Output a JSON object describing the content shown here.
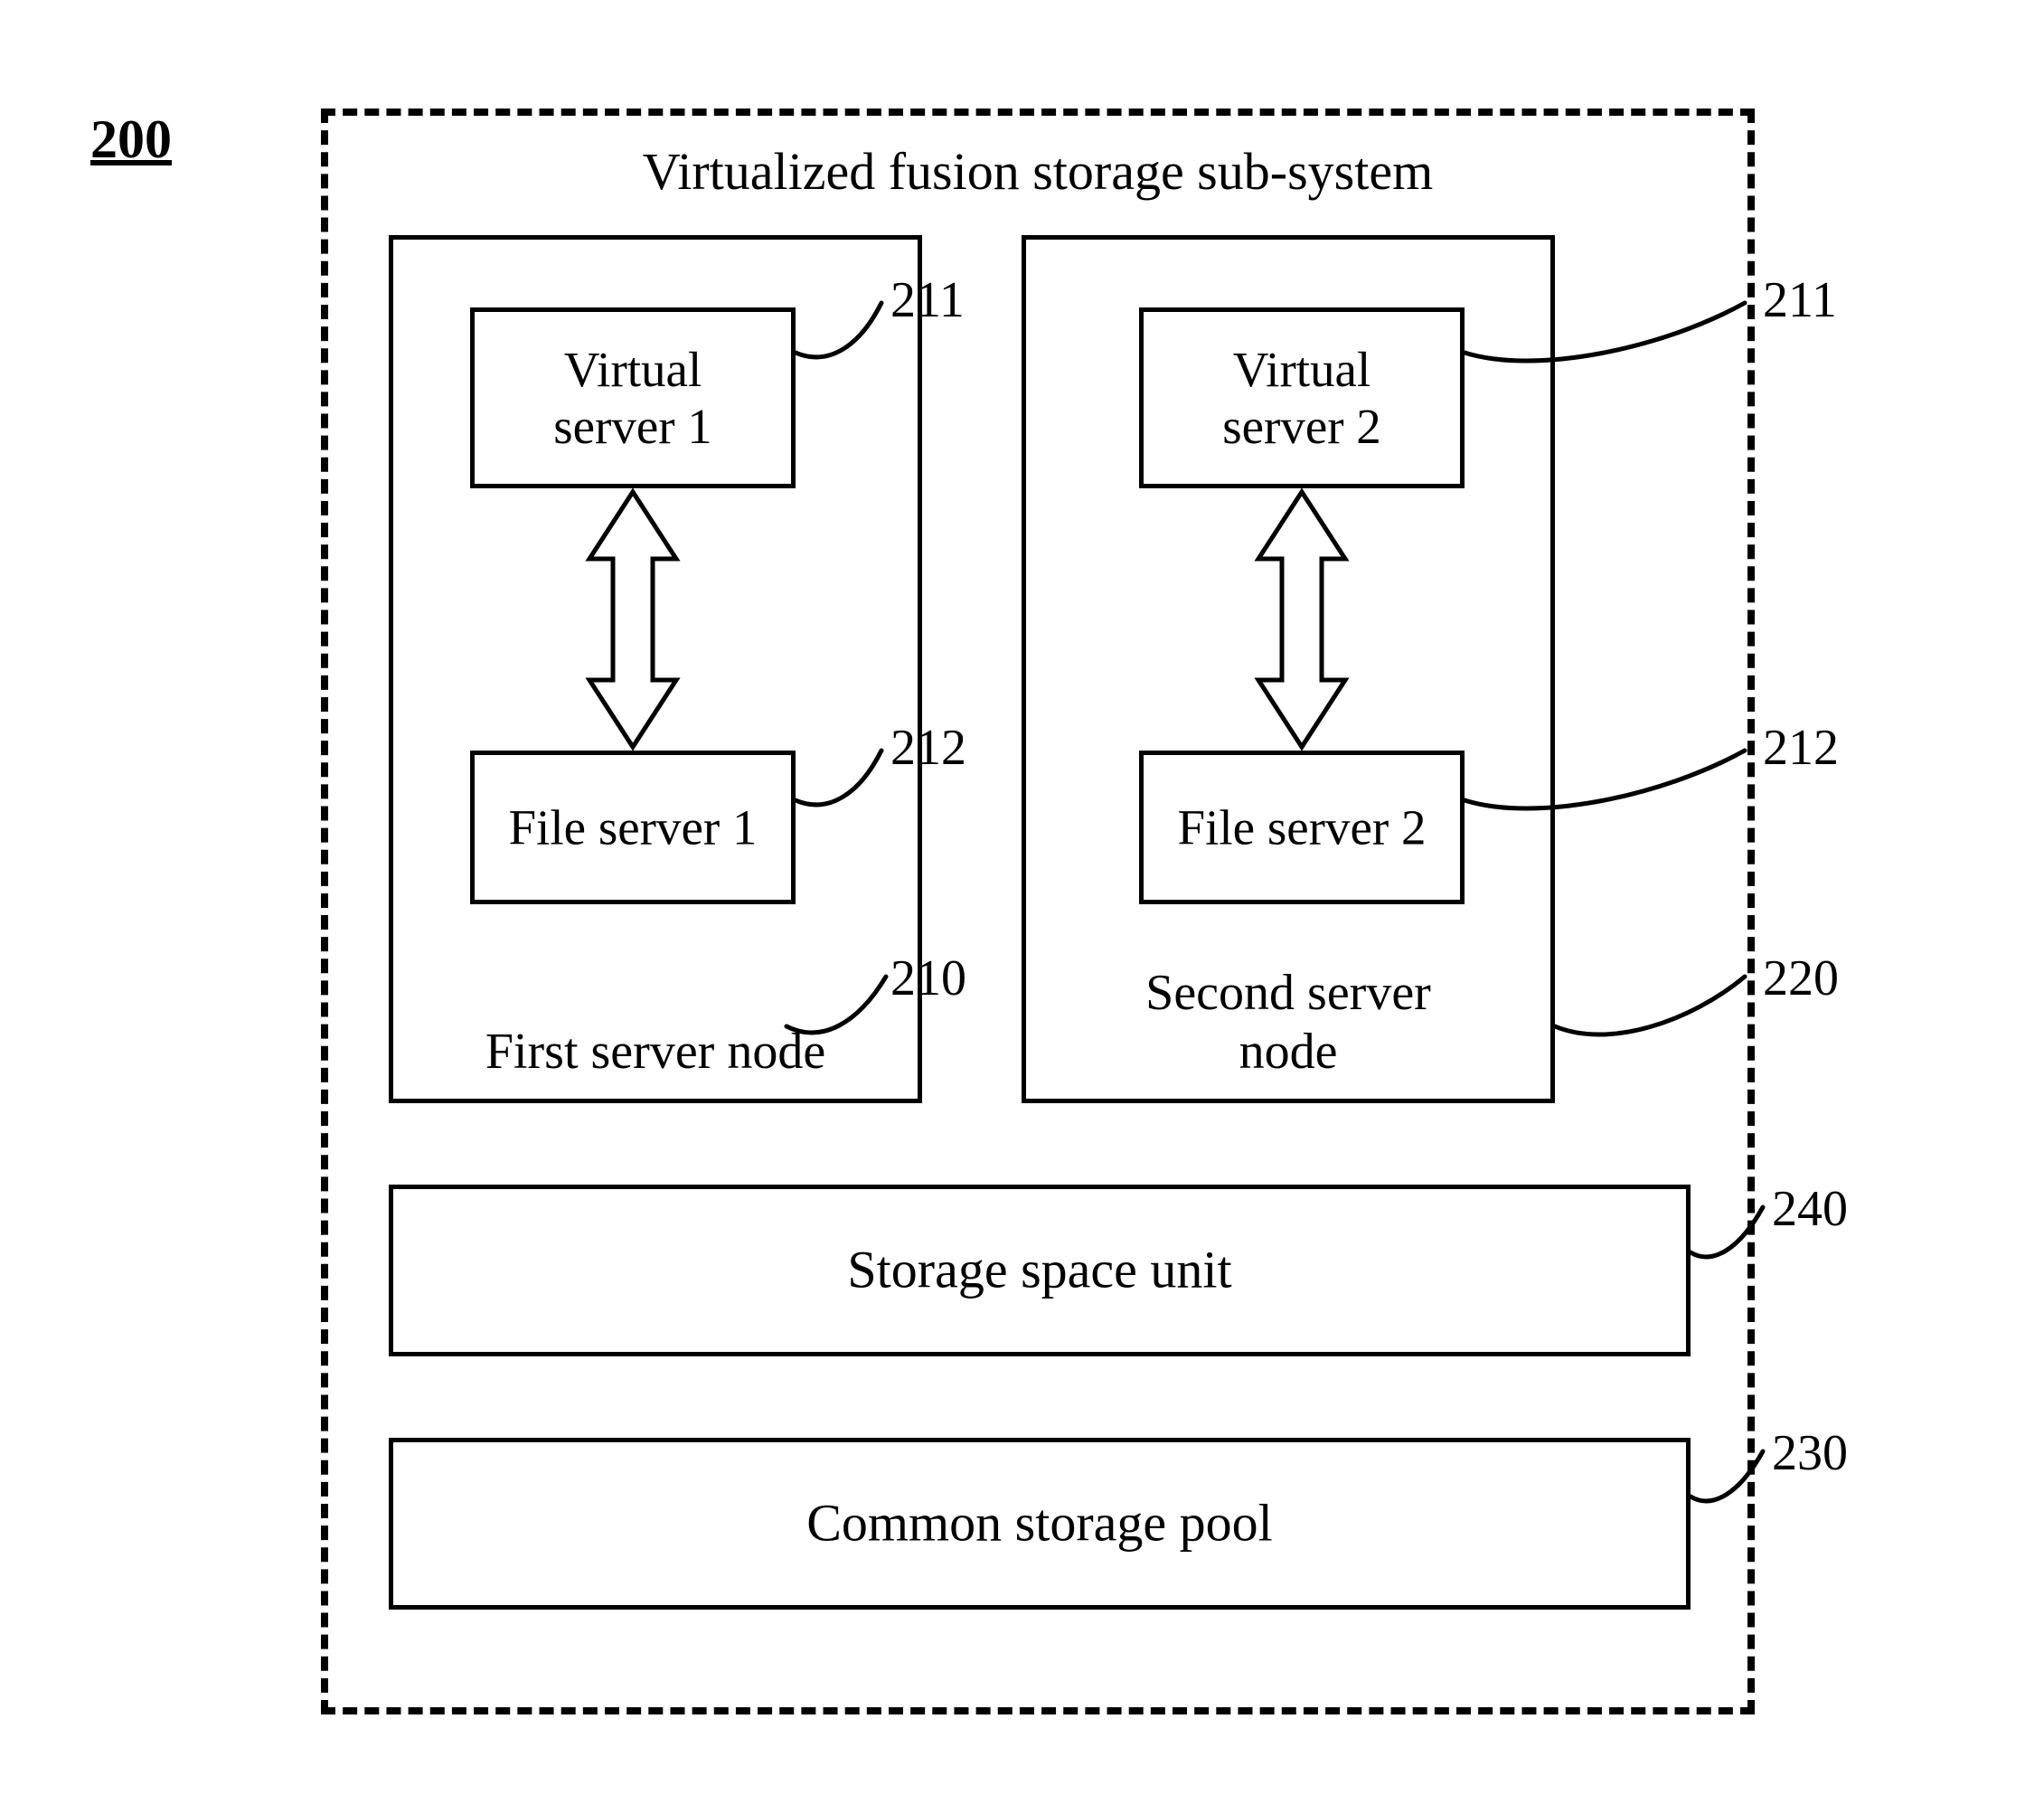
{
  "figure_number": "200",
  "outer_title": "Virtualized fusion storage sub-system",
  "node1": {
    "label": "First server node",
    "vs": "Virtual\nserver 1",
    "fs": "File server 1"
  },
  "node2": {
    "label": "Second server\nnode",
    "vs": "Virtual\nserver 2",
    "fs": "File server 2"
  },
  "storage_space_unit": "Storage space unit",
  "common_storage_pool": "Common storage pool",
  "refs": {
    "vs1": "211",
    "fs1": "212",
    "node1": "210",
    "vs2": "211",
    "fs2": "212",
    "node2": "220",
    "ssu": "240",
    "csp": "230"
  }
}
